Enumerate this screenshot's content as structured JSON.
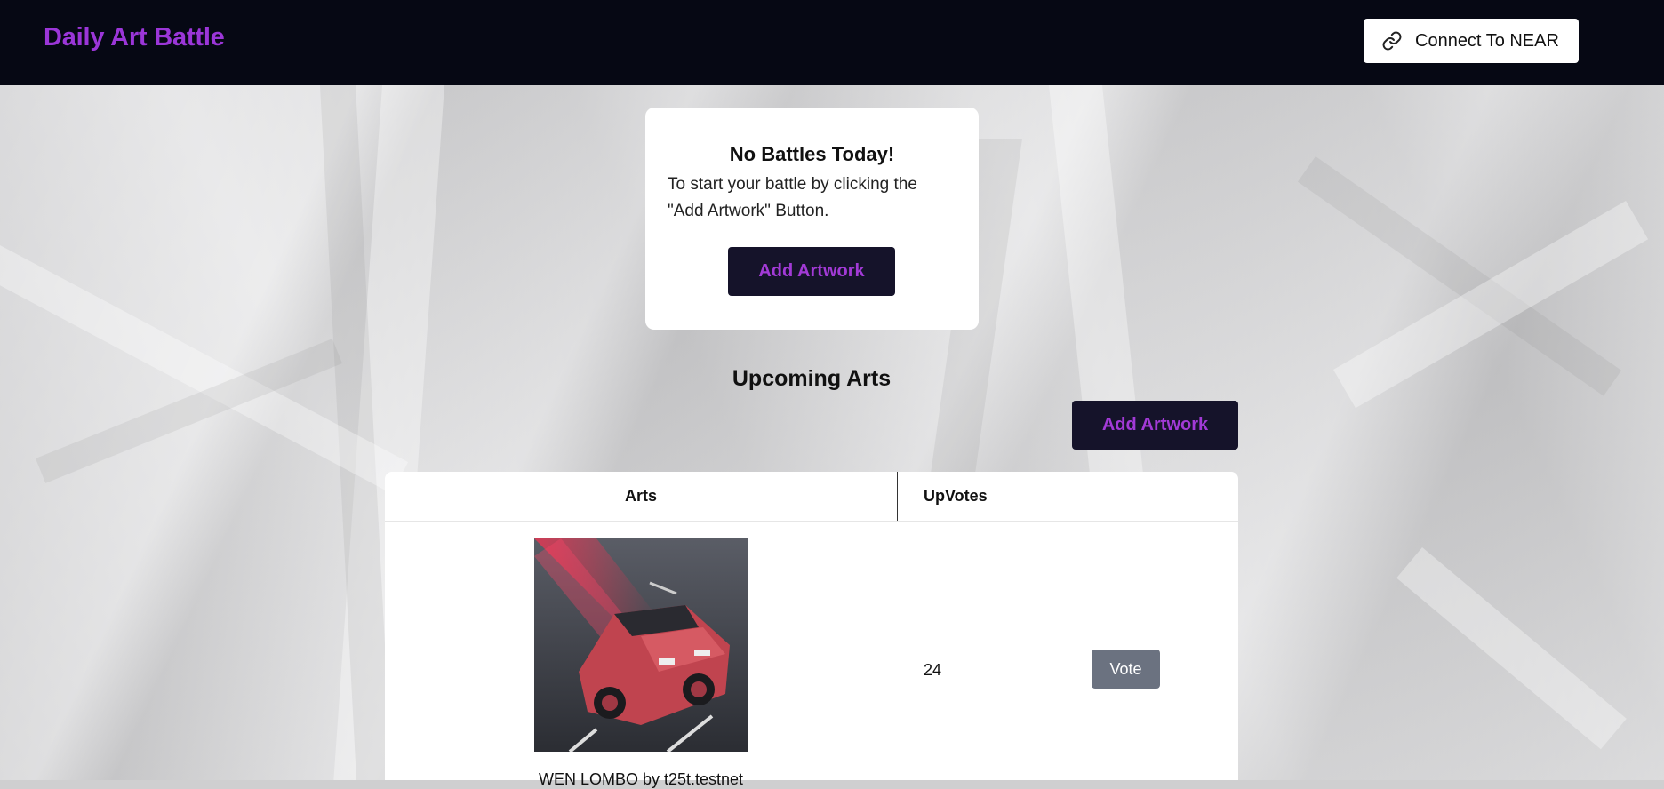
{
  "header": {
    "brand": "Daily Art Battle",
    "connect_label": "Connect To NEAR",
    "connect_icon": "link-icon"
  },
  "battle_card": {
    "title": "No Battles Today!",
    "description": "To start your battle by clicking the \"Add Artwork\" Button.",
    "button_label": "Add Artwork"
  },
  "upcoming": {
    "title": "Upcoming Arts",
    "add_button_label": "Add Artwork",
    "table": {
      "headers": [
        "Arts",
        "UpVotes"
      ],
      "rows": [
        {
          "caption": "WEN LOMBO by t25t.testnet",
          "upvotes": "24",
          "vote_label": "Vote"
        }
      ]
    }
  },
  "colors": {
    "header_bg": "#060814",
    "brand": "#9b36d8",
    "accent_button_bg": "#15132a",
    "accent_button_text": "#a23ad6",
    "vote_button": "#6b7280"
  }
}
